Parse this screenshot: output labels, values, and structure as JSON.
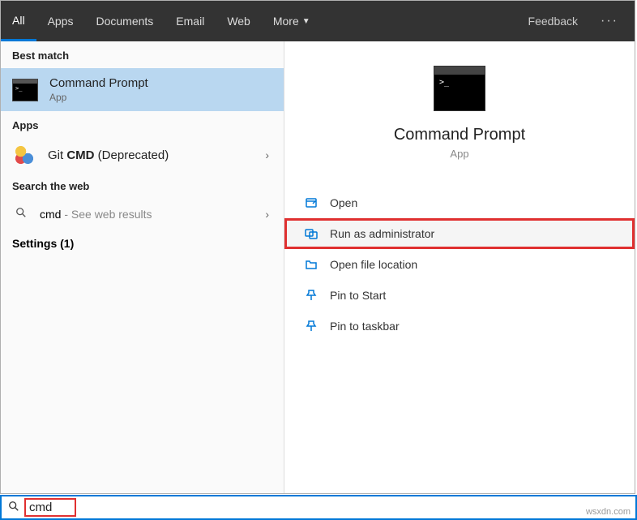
{
  "topbar": {
    "tabs": [
      "All",
      "Apps",
      "Documents",
      "Email",
      "Web",
      "More"
    ],
    "feedback": "Feedback",
    "more_indicator": "▼"
  },
  "left": {
    "best_match_header": "Best match",
    "selected": {
      "title": "Command Prompt",
      "subtitle": "App"
    },
    "apps_header": "Apps",
    "git": {
      "prefix": "Git ",
      "bold": "CMD",
      "suffix": " (Deprecated)"
    },
    "search_web_header": "Search the web",
    "web": {
      "query": "cmd",
      "suffix": " - See web results"
    },
    "settings": {
      "label": "Settings (1)"
    }
  },
  "preview": {
    "title": "Command Prompt",
    "subtitle": "App",
    "actions": {
      "open": "Open",
      "admin": "Run as administrator",
      "location": "Open file location",
      "pin_start": "Pin to Start",
      "pin_taskbar": "Pin to taskbar"
    }
  },
  "search": {
    "query": "cmd"
  },
  "watermark": "wsxdn.com"
}
